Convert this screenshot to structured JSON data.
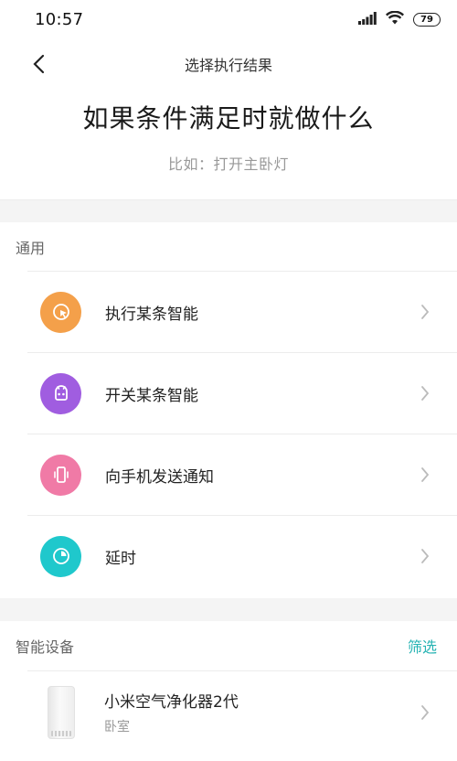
{
  "status_bar": {
    "time": "10:57",
    "battery": "79"
  },
  "nav": {
    "title": "选择执行结果"
  },
  "hero": {
    "title": "如果条件满足时就做什么",
    "subtitle": "比如：打开主卧灯"
  },
  "general": {
    "title": "通用",
    "items": [
      {
        "label": "执行某条智能",
        "icon": "cursor-click-icon",
        "color": "#f4a04a"
      },
      {
        "label": "开关某条智能",
        "icon": "robot-icon",
        "color": "#a05de0"
      },
      {
        "label": "向手机发送通知",
        "icon": "phone-vibrate-icon",
        "color": "#f07aa6"
      },
      {
        "label": "延时",
        "icon": "timer-icon",
        "color": "#1fc8cc"
      }
    ]
  },
  "devices": {
    "title": "智能设备",
    "filter_label": "筛选",
    "items": [
      {
        "name": "小米空气净化器2代",
        "room": "卧室",
        "icon": "air-purifier-image"
      }
    ]
  },
  "colors": {
    "accent": "#25b3b3",
    "divider": "#ececec",
    "band": "#f4f4f4"
  }
}
